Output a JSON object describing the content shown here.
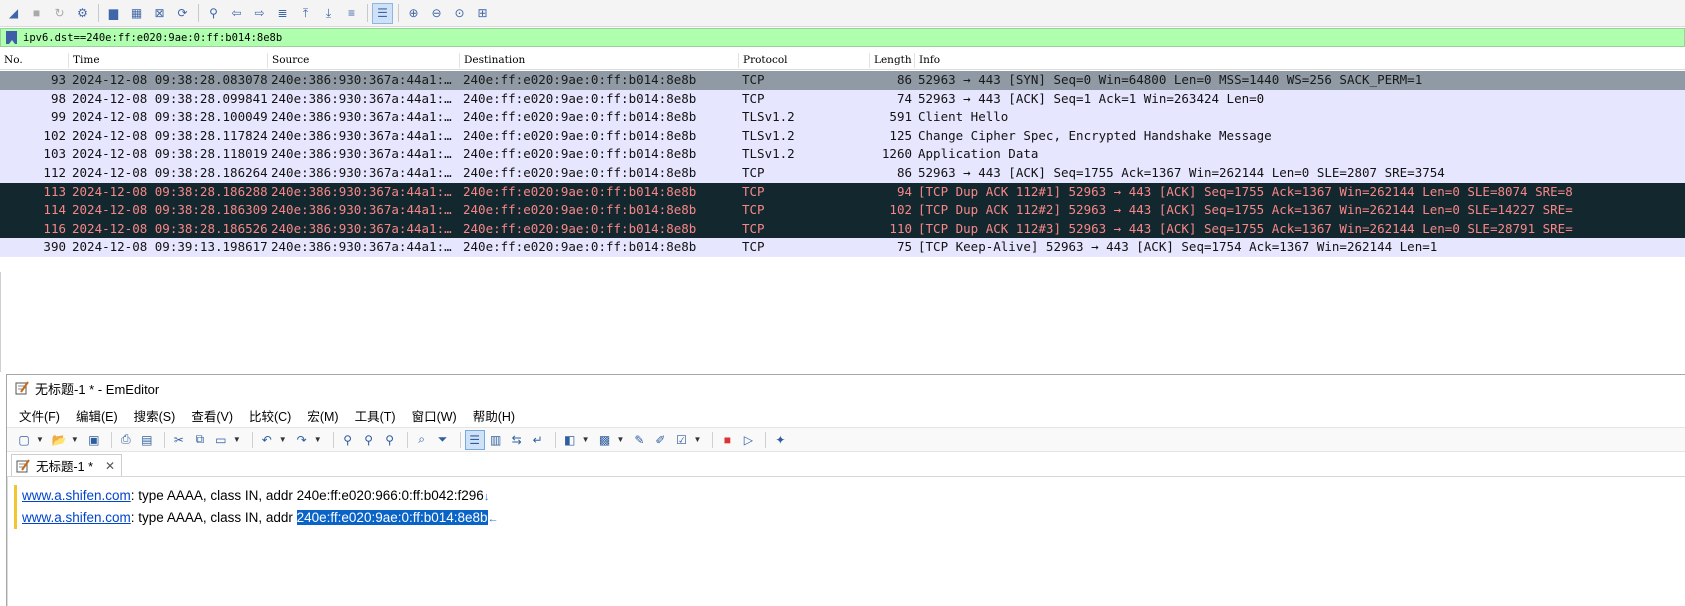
{
  "wireshark": {
    "toolbar": {
      "buttons": [
        {
          "name": "shark-fin-start-icon",
          "glyph": "◢",
          "state": "normal"
        },
        {
          "name": "stop-capture-icon",
          "glyph": "■",
          "state": "dim"
        },
        {
          "name": "restart-capture-icon",
          "glyph": "↻",
          "state": "dim"
        },
        {
          "name": "capture-options-gear-icon",
          "glyph": "⚙",
          "state": "normal"
        },
        {
          "sep": true
        },
        {
          "name": "open-file-icon",
          "glyph": "▆",
          "state": "normal"
        },
        {
          "name": "save-file-icon",
          "glyph": "▦",
          "state": "normal"
        },
        {
          "name": "close-file-icon",
          "glyph": "⊠",
          "state": "normal"
        },
        {
          "name": "reload-file-icon",
          "glyph": "⟳",
          "state": "normal"
        },
        {
          "sep": true
        },
        {
          "name": "find-packet-icon",
          "glyph": "⚲",
          "state": "normal"
        },
        {
          "name": "go-back-icon",
          "glyph": "⇦",
          "state": "normal"
        },
        {
          "name": "go-forward-icon",
          "glyph": "⇨",
          "state": "normal"
        },
        {
          "name": "go-to-packet-icon",
          "glyph": "≣",
          "state": "normal"
        },
        {
          "name": "go-first-icon",
          "glyph": "⤒",
          "state": "normal"
        },
        {
          "name": "go-last-icon",
          "glyph": "⤓",
          "state": "normal"
        },
        {
          "name": "autoscroll-icon",
          "glyph": "≡",
          "state": "normal"
        },
        {
          "sep": true
        },
        {
          "name": "colorize-icon",
          "glyph": "☰",
          "state": "selected"
        },
        {
          "sep": true
        },
        {
          "name": "zoom-in-icon",
          "glyph": "⊕",
          "state": "normal"
        },
        {
          "name": "zoom-out-icon",
          "glyph": "⊖",
          "state": "normal"
        },
        {
          "name": "zoom-normal-icon",
          "glyph": "⊙",
          "state": "normal"
        },
        {
          "name": "resize-columns-icon",
          "glyph": "⊞",
          "state": "normal"
        }
      ]
    },
    "filter": {
      "value": "ipv6.dst==240e:ff:e020:9ae:0:ff:b014:8e8b"
    },
    "columns": [
      "No.",
      "Time",
      "Source",
      "Destination",
      "Protocol",
      "Length",
      "Info"
    ],
    "colors": {
      "tcp_light": "#e7e6ff",
      "selected": "#8f9aa5",
      "dup_ack_bg": "#12272e",
      "dup_ack_fg": "#f78787",
      "header_border": "#dcdcdc"
    },
    "packets": [
      {
        "no": "93",
        "time": "2024-12-08 09:38:28.083078",
        "src": "240e:386:930:367a:44a1:…",
        "dst": "240e:ff:e020:9ae:0:ff:b014:8e8b",
        "proto": "TCP",
        "len": "86",
        "info": "52963 → 443 [SYN] Seq=0 Win=64800 Len=0 MSS=1440 WS=256 SACK_PERM=1",
        "style": "selected"
      },
      {
        "no": "98",
        "time": "2024-12-08 09:38:28.099841",
        "src": "240e:386:930:367a:44a1:…",
        "dst": "240e:ff:e020:9ae:0:ff:b014:8e8b",
        "proto": "TCP",
        "len": "74",
        "info": "52963 → 443 [ACK] Seq=1 Ack=1 Win=263424 Len=0",
        "style": "tcp"
      },
      {
        "no": "99",
        "time": "2024-12-08 09:38:28.100049",
        "src": "240e:386:930:367a:44a1:…",
        "dst": "240e:ff:e020:9ae:0:ff:b014:8e8b",
        "proto": "TLSv1.2",
        "len": "591",
        "info": "Client Hello",
        "style": "tcp"
      },
      {
        "no": "102",
        "time": "2024-12-08 09:38:28.117824",
        "src": "240e:386:930:367a:44a1:…",
        "dst": "240e:ff:e020:9ae:0:ff:b014:8e8b",
        "proto": "TLSv1.2",
        "len": "125",
        "info": "Change Cipher Spec, Encrypted Handshake Message",
        "style": "tcp"
      },
      {
        "no": "103",
        "time": "2024-12-08 09:38:28.118019",
        "src": "240e:386:930:367a:44a1:…",
        "dst": "240e:ff:e020:9ae:0:ff:b014:8e8b",
        "proto": "TLSv1.2",
        "len": "1260",
        "info": "Application Data",
        "style": "tcp"
      },
      {
        "no": "112",
        "time": "2024-12-08 09:38:28.186264",
        "src": "240e:386:930:367a:44a1:…",
        "dst": "240e:ff:e020:9ae:0:ff:b014:8e8b",
        "proto": "TCP",
        "len": "86",
        "info": "52963 → 443 [ACK] Seq=1755 Ack=1367 Win=262144 Len=0 SLE=2807 SRE=3754",
        "style": "tcp"
      },
      {
        "no": "113",
        "time": "2024-12-08 09:38:28.186288",
        "src": "240e:386:930:367a:44a1:…",
        "dst": "240e:ff:e020:9ae:0:ff:b014:8e8b",
        "proto": "TCP",
        "len": "94",
        "info": "[TCP Dup ACK 112#1] 52963 → 443 [ACK] Seq=1755 Ack=1367 Win=262144 Len=0 SLE=8074 SRE=8",
        "style": "dup"
      },
      {
        "no": "114",
        "time": "2024-12-08 09:38:28.186309",
        "src": "240e:386:930:367a:44a1:…",
        "dst": "240e:ff:e020:9ae:0:ff:b014:8e8b",
        "proto": "TCP",
        "len": "102",
        "info": "[TCP Dup ACK 112#2] 52963 → 443 [ACK] Seq=1755 Ack=1367 Win=262144 Len=0 SLE=14227 SRE=",
        "style": "dup"
      },
      {
        "no": "116",
        "time": "2024-12-08 09:38:28.186526",
        "src": "240e:386:930:367a:44a1:…",
        "dst": "240e:ff:e020:9ae:0:ff:b014:8e8b",
        "proto": "TCP",
        "len": "110",
        "info": "[TCP Dup ACK 112#3] 52963 → 443 [ACK] Seq=1755 Ack=1367 Win=262144 Len=0 SLE=28791 SRE=",
        "style": "dup"
      },
      {
        "no": "390",
        "time": "2024-12-08 09:39:13.198617",
        "src": "240e:386:930:367a:44a1:…",
        "dst": "240e:ff:e020:9ae:0:ff:b014:8e8b",
        "proto": "TCP",
        "len": "75",
        "info": "[TCP Keep-Alive] 52963 → 443 [ACK] Seq=1754 Ack=1367 Win=262144 Len=1",
        "style": "tcp"
      }
    ]
  },
  "emeditor": {
    "title": "无标题-1 * - EmEditor",
    "menu": [
      "文件(F)",
      "编辑(E)",
      "搜索(S)",
      "查看(V)",
      "比较(C)",
      "宏(M)",
      "工具(T)",
      "窗口(W)",
      "帮助(H)"
    ],
    "toolbar": [
      {
        "name": "new-file-icon",
        "glyph": "▢",
        "dd": true
      },
      {
        "name": "open-folder-icon",
        "glyph": "📂",
        "dd": true
      },
      {
        "name": "save-icon",
        "glyph": "▣"
      },
      {
        "sep": true
      },
      {
        "name": "print-icon",
        "glyph": "⎙"
      },
      {
        "name": "print-preview-icon",
        "glyph": "▤"
      },
      {
        "sep": true
      },
      {
        "name": "cut-icon",
        "glyph": "✂"
      },
      {
        "name": "copy-icon",
        "glyph": "⧉"
      },
      {
        "name": "paste-icon",
        "glyph": "▭",
        "dd": true
      },
      {
        "sep": true
      },
      {
        "name": "undo-icon",
        "glyph": "↶",
        "dd": true
      },
      {
        "name": "redo-icon",
        "glyph": "↷",
        "dd": true
      },
      {
        "sep": true
      },
      {
        "name": "find-icon",
        "glyph": "⚲"
      },
      {
        "name": "find-next-icon",
        "glyph": "⚲"
      },
      {
        "name": "find-prev-icon",
        "glyph": "⚲"
      },
      {
        "sep": true
      },
      {
        "name": "find-in-files-icon",
        "glyph": "⌕"
      },
      {
        "name": "filter-icon",
        "glyph": "⏷"
      },
      {
        "sep": true
      },
      {
        "name": "wrap-none-icon",
        "glyph": "☰",
        "selected": true
      },
      {
        "name": "wrap-window-icon",
        "glyph": "▥"
      },
      {
        "name": "wrap-page-icon",
        "glyph": "⇆"
      },
      {
        "name": "wrap-icon",
        "glyph": "↵"
      },
      {
        "sep": true
      },
      {
        "name": "encoding-icon",
        "glyph": "◧",
        "dd": true
      },
      {
        "name": "config-icon",
        "glyph": "▩",
        "dd": true
      },
      {
        "name": "macro-icon",
        "glyph": "✎"
      },
      {
        "name": "macro-run-icon",
        "glyph": "✐"
      },
      {
        "name": "checklist-icon",
        "glyph": "☑",
        "dd": true
      },
      {
        "sep": true
      },
      {
        "name": "record-macro-icon",
        "glyph": "■",
        "color": "#d33"
      },
      {
        "name": "play-macro-icon",
        "glyph": "▷"
      },
      {
        "sep": true
      },
      {
        "name": "plugin-icon",
        "glyph": "✦"
      }
    ],
    "tab_label": "无标题-1 *",
    "lines": [
      {
        "domain": "www.a.shifen.com",
        "mid": ": type AAAA, class IN, addr ",
        "addr": "240e:ff:e020:966:0:ff:b042:f296",
        "selected": false,
        "eol": "↓"
      },
      {
        "domain": "www.a.shifen.com",
        "mid": ": type AAAA, class IN, addr ",
        "addr": "240e:ff:e020:9ae:0:ff:b014:8e8b",
        "selected": true,
        "eol": "←"
      }
    ]
  }
}
